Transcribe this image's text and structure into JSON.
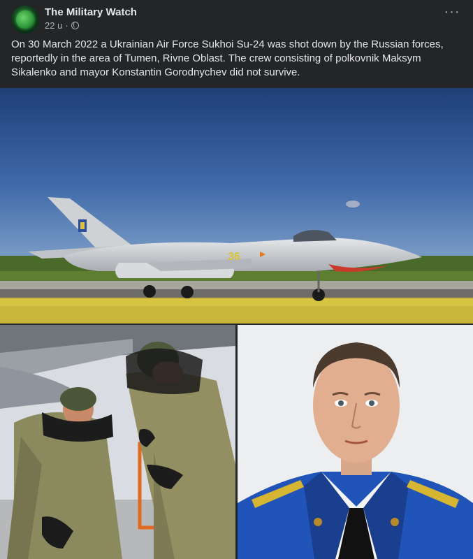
{
  "post": {
    "page_name": "The Military Watch",
    "time": "22 u",
    "separator": "·",
    "privacy_icon": "globe-icon",
    "more_label": "···",
    "text": "On 30 March 2022 a Ukrainian Air Force Sukhoi Su-24 was shot down by the Russian forces, reportedly in the area of Tumen, Rivne Oblast. The crew consisting of polkovnik Maksym Sikalenko and mayor Konstantin Gorodnychev did not survive."
  },
  "images": {
    "aircraft_tail_number": "36"
  },
  "colors": {
    "background": "#242526",
    "text_primary": "#e4e6eb",
    "text_secondary": "#b0b3b8"
  }
}
